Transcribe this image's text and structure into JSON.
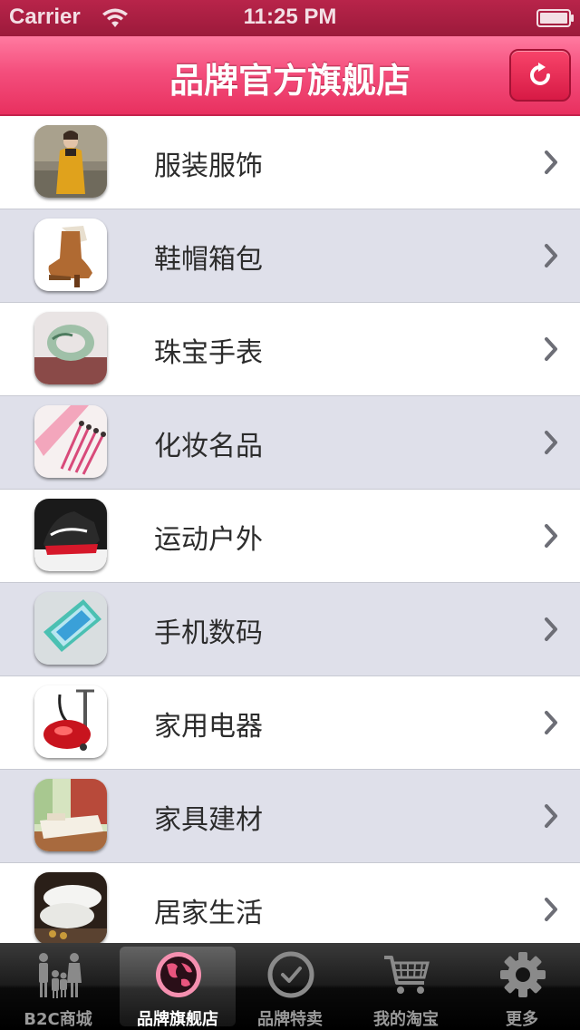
{
  "status_bar": {
    "carrier": "Carrier",
    "time": "11:25 PM"
  },
  "nav_bar": {
    "title": "品牌官方旗舰店"
  },
  "categories": [
    {
      "label": "服装服饰",
      "icon": "clothing-thumbnail"
    },
    {
      "label": "鞋帽箱包",
      "icon": "boot-thumbnail"
    },
    {
      "label": "珠宝手表",
      "icon": "jade-bracelet-thumbnail"
    },
    {
      "label": "化妆名品",
      "icon": "makeup-brushes-thumbnail"
    },
    {
      "label": "运动户外",
      "icon": "sneaker-thumbnail"
    },
    {
      "label": "手机数码",
      "icon": "smartphone-thumbnail"
    },
    {
      "label": "家用电器",
      "icon": "garment-steamer-thumbnail"
    },
    {
      "label": "家具建材",
      "icon": "bedroom-thumbnail"
    },
    {
      "label": "居家生活",
      "icon": "pillow-thumbnail"
    }
  ],
  "tab_bar": {
    "tabs": [
      {
        "label": "B2C商城",
        "icon": "people-icon"
      },
      {
        "label": "品牌旗舰店",
        "icon": "globe-icon"
      },
      {
        "label": "品牌特卖",
        "icon": "clock-icon"
      },
      {
        "label": "我的淘宝",
        "icon": "cart-icon"
      },
      {
        "label": "更多",
        "icon": "gear-icon"
      }
    ],
    "selected": "品牌旗舰店"
  },
  "colors": {
    "nav_pink": "#f44f7d",
    "status_bar": "#9c1a3b",
    "row_alt": "#dfe0ea"
  }
}
